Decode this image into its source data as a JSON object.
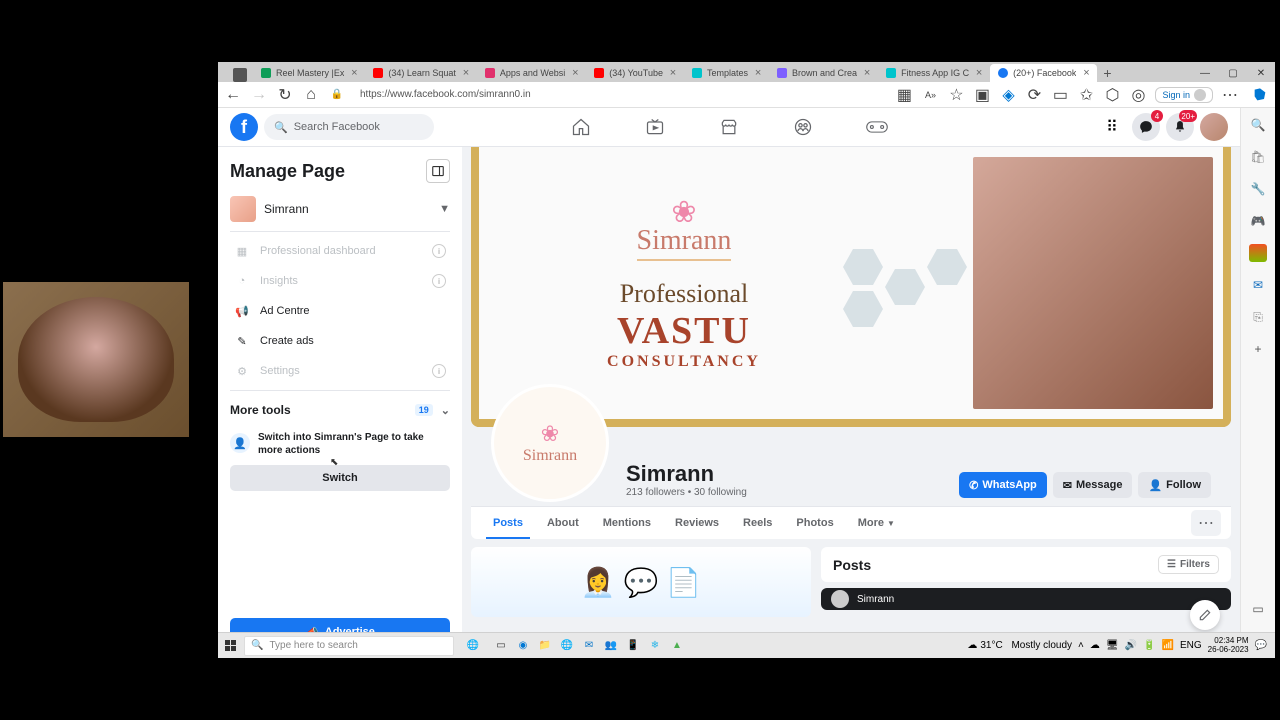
{
  "browser": {
    "tabs": [
      {
        "title": "Reel Mastery |Ex",
        "fav": "#0f9d58"
      },
      {
        "title": "(34) Learn Squat",
        "fav": "#ff0000"
      },
      {
        "title": "Apps and Websi",
        "fav": "#e1306c"
      },
      {
        "title": "(34) YouTube",
        "fav": "#ff0000"
      },
      {
        "title": "Templates",
        "fav": "#00c4cc"
      },
      {
        "title": "Brown and Crea",
        "fav": "#7d5fff"
      },
      {
        "title": "Fitness App IG C",
        "fav": "#00c4cc"
      },
      {
        "title": "(20+) Facebook",
        "fav": "#1877f2",
        "active": true
      }
    ],
    "url": "https://www.facebook.com/simrann0.in",
    "signin": "Sign in"
  },
  "facebook": {
    "search_placeholder": "Search Facebook",
    "left": {
      "title": "Manage Page",
      "page_name": "Simrann",
      "items": [
        {
          "label": "Professional dashboard",
          "disabled": true,
          "info": true
        },
        {
          "label": "Insights",
          "disabled": true,
          "info": true
        },
        {
          "label": "Ad Centre",
          "disabled": false
        },
        {
          "label": "Create ads",
          "disabled": false
        },
        {
          "label": "Settings",
          "disabled": true,
          "info": true
        }
      ],
      "more_tools": "More tools",
      "more_tools_count": "19",
      "switch_text": "Switch into Simrann's Page to take more actions",
      "switch_btn": "Switch",
      "advertise": "Advertise"
    },
    "header": {
      "badge_msg": "4",
      "badge_notif": "20+"
    },
    "profile": {
      "name": "Simrann",
      "stats": "213 followers • 30 following",
      "cover_main": "VASTU",
      "cover_sub": "Professional",
      "cover_cons": "CONSULTANCY",
      "cover_brand": "Simrann"
    },
    "actions": {
      "whatsapp": "WhatsApp",
      "message": "Message",
      "follow": "Follow"
    },
    "tabs": [
      "Posts",
      "About",
      "Mentions",
      "Reviews",
      "Reels",
      "Photos"
    ],
    "more": "More",
    "posts_header": "Posts",
    "filters": "Filters",
    "post_author": "Simrann"
  },
  "taskbar": {
    "search_placeholder": "Type here to search",
    "weather_temp": "31°C",
    "weather_text": "Mostly cloudy",
    "lang": "ENG",
    "time": "02:34 PM",
    "date": "26-06-2023"
  }
}
